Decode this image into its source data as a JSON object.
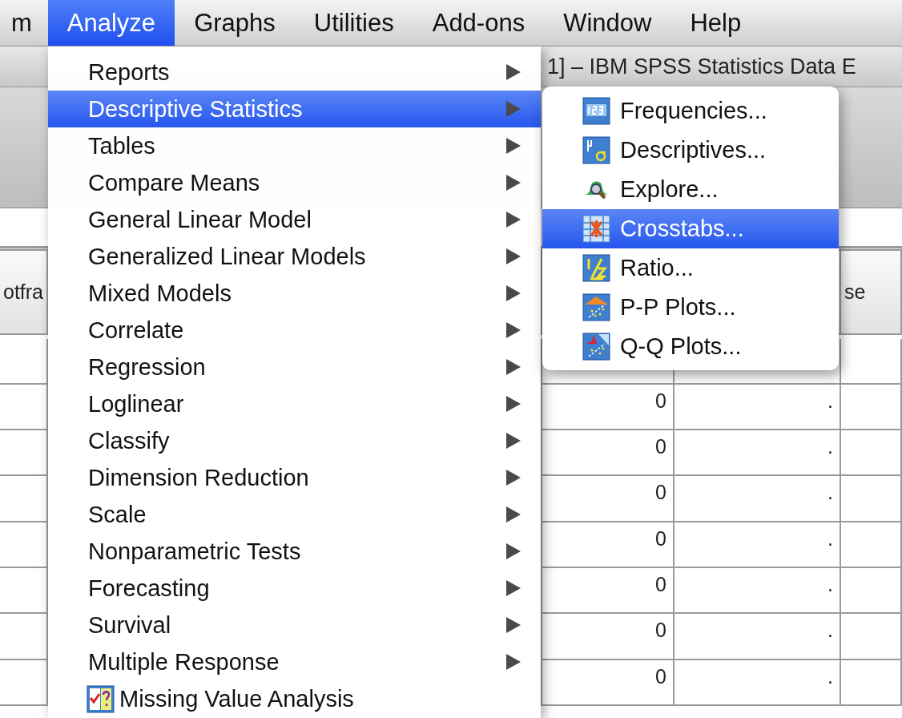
{
  "menubar": {
    "items": [
      {
        "label": "m",
        "selected": false
      },
      {
        "label": "Analyze",
        "selected": true
      },
      {
        "label": "Graphs",
        "selected": false
      },
      {
        "label": "Utilities",
        "selected": false
      },
      {
        "label": "Add-ons",
        "selected": false
      },
      {
        "label": "Window",
        "selected": false
      },
      {
        "label": "Help",
        "selected": false
      }
    ]
  },
  "window": {
    "title": "1] – IBM SPSS Statistics Data E"
  },
  "grid": {
    "headers": {
      "column_1": "otfra",
      "column_5": "se"
    },
    "rows": [
      {
        "column_3": "0",
        "column_4": "."
      },
      {
        "column_3": "0",
        "column_4": "."
      },
      {
        "column_3": "0",
        "column_4": "."
      },
      {
        "column_3": "0",
        "column_4": "."
      },
      {
        "column_3": "0",
        "column_4": "."
      },
      {
        "column_3": "0",
        "column_4": "."
      },
      {
        "column_3": "0",
        "column_4": "."
      }
    ]
  },
  "analyze_menu": {
    "items": [
      {
        "label": "Reports",
        "has_submenu": true,
        "selected": false
      },
      {
        "label": "Descriptive Statistics",
        "has_submenu": true,
        "selected": true
      },
      {
        "label": "Tables",
        "has_submenu": true,
        "selected": false
      },
      {
        "label": "Compare Means",
        "has_submenu": true,
        "selected": false
      },
      {
        "label": "General Linear Model",
        "has_submenu": true,
        "selected": false
      },
      {
        "label": "Generalized Linear Models",
        "has_submenu": true,
        "selected": false
      },
      {
        "label": "Mixed Models",
        "has_submenu": true,
        "selected": false
      },
      {
        "label": "Correlate",
        "has_submenu": true,
        "selected": false
      },
      {
        "label": "Regression",
        "has_submenu": true,
        "selected": false
      },
      {
        "label": "Loglinear",
        "has_submenu": true,
        "selected": false
      },
      {
        "label": "Classify",
        "has_submenu": true,
        "selected": false
      },
      {
        "label": "Dimension Reduction",
        "has_submenu": true,
        "selected": false
      },
      {
        "label": "Scale",
        "has_submenu": true,
        "selected": false
      },
      {
        "label": "Nonparametric Tests",
        "has_submenu": true,
        "selected": false
      },
      {
        "label": "Forecasting",
        "has_submenu": true,
        "selected": false
      },
      {
        "label": "Survival",
        "has_submenu": true,
        "selected": false
      },
      {
        "label": "Multiple Response",
        "has_submenu": true,
        "selected": false
      },
      {
        "label": "Missing Value Analysis",
        "has_submenu": false,
        "selected": false,
        "kind": "icon"
      }
    ]
  },
  "descriptive_submenu": {
    "items": [
      {
        "label": "Frequencies...",
        "selected": false
      },
      {
        "label": "Descriptives...",
        "selected": false
      },
      {
        "label": "Explore...",
        "selected": false
      },
      {
        "label": "Crosstabs...",
        "selected": true
      },
      {
        "label": "Ratio...",
        "selected": false
      },
      {
        "label": "P-P Plots...",
        "selected": false
      },
      {
        "label": "Q-Q Plots...",
        "selected": false
      }
    ]
  }
}
